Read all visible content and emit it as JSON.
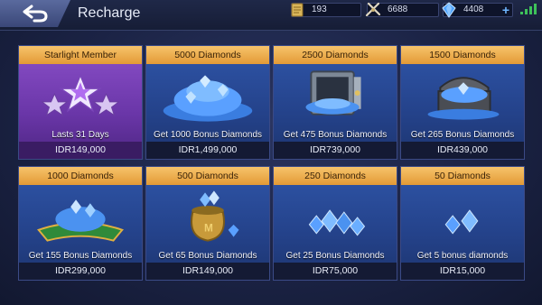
{
  "header": {
    "title": "Recharge",
    "resources": [
      {
        "icon": "battle-points-icon",
        "value": "193"
      },
      {
        "icon": "tickets-icon",
        "value": "6688"
      },
      {
        "icon": "diamond-icon",
        "value": "4408",
        "action": "+"
      }
    ]
  },
  "colors": {
    "card_header": "#e39a36",
    "card_body": "#2f55a8",
    "starlight_body": "#8a4fc8",
    "price_bar": "#141a34",
    "signal": "#3ec25a"
  },
  "cards": [
    {
      "title": "Starlight Member",
      "bonus": "Lasts 31 Days",
      "price": "IDR149,000",
      "art": "starlight-stars-icon"
    },
    {
      "title": "5000 Diamonds",
      "bonus": "Get 1000 Bonus Diamonds",
      "price": "IDR1,499,000",
      "art": "diamond-pile-icon"
    },
    {
      "title": "2500 Diamonds",
      "bonus": "Get 475 Bonus Diamonds",
      "price": "IDR739,000",
      "art": "diamond-safe-icon"
    },
    {
      "title": "1500 Diamonds",
      "bonus": "Get 265 Bonus Diamonds",
      "price": "IDR439,000",
      "art": "diamond-chest-icon"
    },
    {
      "title": "1000 Diamonds",
      "bonus": "Get 155 Bonus Diamonds",
      "price": "IDR299,000",
      "art": "diamond-cushion-icon"
    },
    {
      "title": "500 Diamonds",
      "bonus": "Get 65 Bonus Diamonds",
      "price": "IDR149,000",
      "art": "diamond-bag-icon"
    },
    {
      "title": "250 Diamonds",
      "bonus": "Get 25 Bonus Diamonds",
      "price": "IDR75,000",
      "art": "diamond-cluster-icon"
    },
    {
      "title": "50 Diamonds",
      "bonus": "Get 5 bonus diamonds",
      "price": "IDR15,000",
      "art": "diamond-few-icon"
    }
  ]
}
